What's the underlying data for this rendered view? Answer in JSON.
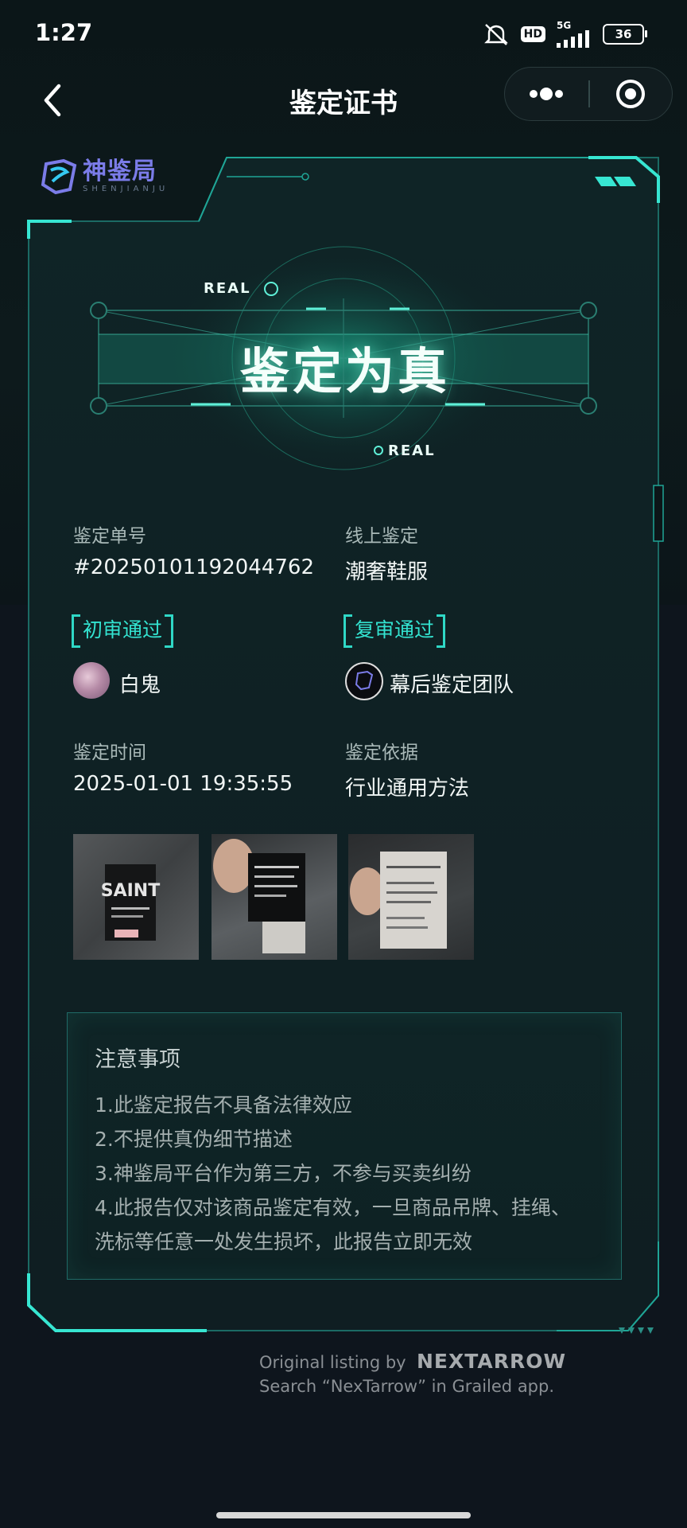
{
  "status_bar": {
    "time": "1:27",
    "hd": "HD",
    "network": "5G",
    "battery": "36"
  },
  "nav": {
    "title": "鉴定证书"
  },
  "brand": {
    "name": "神鉴局",
    "sub": "SHENJIANJU"
  },
  "hero": {
    "result": "鉴定为真",
    "tag_top": "REAL",
    "tag_bottom": "REAL"
  },
  "info": {
    "order_label": "鉴定单号",
    "order_value": "#20250101192044762",
    "channel_label": "线上鉴定",
    "channel_value": "潮奢鞋服",
    "first_review": {
      "tag": "初审通过",
      "name": "白鬼"
    },
    "second_review": {
      "tag": "复审通过",
      "name": "幕后鉴定团队"
    },
    "time_label": "鉴定时间",
    "time_value": "2025-01-01 19:35:55",
    "basis_label": "鉴定依据",
    "basis_value": "行业通用方法"
  },
  "photos": [
    "photo-1",
    "photo-2",
    "photo-3"
  ],
  "notice": {
    "title": "注意事项",
    "lines": [
      "1.此鉴定报告不具备法律效应",
      "2.不提供真伪细节描述",
      "3.神鉴局平台作为第三方，不参与买卖纠纷",
      "4.此报告仅对该商品鉴定有效，一旦商品吊牌、挂绳、",
      "洗标等任意一处发生损坏，此报告立即无效"
    ]
  },
  "watermark": {
    "line1_prefix": "Original listing by",
    "brand": "NEXTARROW",
    "line2": "Search “NexTarrow” in Grailed app."
  },
  "colors": {
    "accent": "#2fd8c6",
    "background": "#0b1216",
    "card": "#0e2224"
  }
}
